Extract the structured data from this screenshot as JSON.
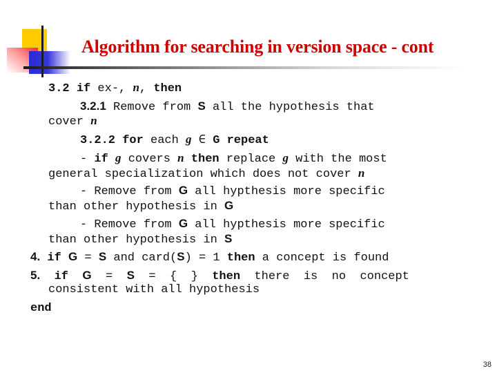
{
  "slide": {
    "title": "Algorithm for searching in version space - cont",
    "page_number": "38",
    "title_color": "#cc0000"
  },
  "lines": {
    "l1": {
      "num": "3.2",
      "kw_if": "if",
      "text1": " ex-, ",
      "var": "n",
      "text2": ", ",
      "kw_then": "then"
    },
    "l2": {
      "num": "3.2.1",
      "text1": " Remove from ",
      "set": "S",
      "text2": " all the hypothesis that"
    },
    "l3": {
      "text1": "cover ",
      "var": "n"
    },
    "l4": {
      "num": "3.2.2",
      "kw_for": "for",
      "text1": " each ",
      "var": "g",
      "text2": " ∈ ",
      "set": "G",
      "kw_repeat": "repeat"
    },
    "l5": {
      "dash": "- ",
      "kw_if": "if",
      "var1": "g",
      "text1": " covers ",
      "var2": "n",
      "kw_then": "then",
      "text2": " replace ",
      "var3": "g",
      "text3": " with the most"
    },
    "l6": {
      "text1": "general specialization which does not cover ",
      "var": "n"
    },
    "l7": {
      "text1": "- Remove from ",
      "set": "G",
      "text2": " all hypthesis more specific"
    },
    "l8": {
      "text1": "than other hypothesis in ",
      "set": "G"
    },
    "l9": {
      "text1": "- Remove from ",
      "set": "G",
      "text2": " all hypthesis more specific"
    },
    "l10": {
      "text1": "than other hypothesis in ",
      "set": "S"
    },
    "l11": {
      "num": "4.",
      "kw_if": "if",
      "set1": "G",
      "text1": " = ",
      "set2": "S",
      "text2": " and card(",
      "set3": "S",
      "text3": ") = 1 ",
      "kw_then": "then",
      "text4": " a concept is found"
    },
    "l12": {
      "num": "5.",
      "kw_if": "if",
      "set1": "G",
      "text1": "  =  ",
      "set2": "S",
      "text2": "  =  {  }  ",
      "kw_then": "then",
      "text3": "  there  is  no  concept"
    },
    "l13": {
      "text1": "consistent with all hypothesis"
    },
    "l14": {
      "kw_end": "end"
    }
  }
}
